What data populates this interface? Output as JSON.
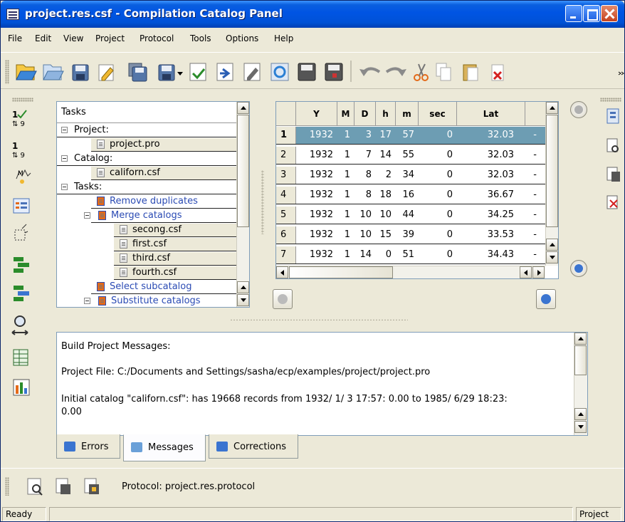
{
  "window": {
    "title": "project.res.csf - Compilation Catalog Panel"
  },
  "menu": [
    "File",
    "Edit",
    "View",
    "Project",
    "Protocol",
    "Tools",
    "Options",
    "Help"
  ],
  "toolbar_icons": [
    "open-folder-icon",
    "open-project-icon",
    "save-icon",
    "edit-icon",
    "save-all-icon",
    "save-as-icon",
    "dropdown-arrow-icon",
    "import-icon",
    "export-icon",
    "edit-catalog-icon",
    "refresh-icon",
    "save-catalog-icon",
    "save-catalog-alt-icon",
    "undo-icon",
    "redo-icon",
    "cut-icon",
    "copy-icon",
    "paste-icon",
    "delete-icon",
    "overflow-icon"
  ],
  "tasks": {
    "header": "Tasks",
    "items": [
      {
        "label": "Project:",
        "level": 0,
        "expander": true
      },
      {
        "label": "project.pro",
        "level": 1,
        "file": true
      },
      {
        "label": "Catalog:",
        "level": 0,
        "expander": true
      },
      {
        "label": "californ.csf",
        "level": 1,
        "file": true
      },
      {
        "label": "Tasks:",
        "level": 0,
        "expander": true
      },
      {
        "label": "Remove duplicates",
        "level": 1,
        "link": true
      },
      {
        "label": "Merge catalogs",
        "level": 1,
        "link": true,
        "expander": true
      },
      {
        "label": "secong.csf",
        "level": 2,
        "file": true
      },
      {
        "label": "first.csf",
        "level": 2,
        "file": true
      },
      {
        "label": "third.csf",
        "level": 2,
        "file": true
      },
      {
        "label": "fourth.csf",
        "level": 2,
        "file": true
      },
      {
        "label": "Select subcatalog",
        "level": 1,
        "link": true
      },
      {
        "label": "Substitute catalogs",
        "level": 1,
        "link": true,
        "expander": true
      }
    ]
  },
  "table": {
    "columns": [
      "Y",
      "M",
      "D",
      "h",
      "m",
      "sec",
      "Lat"
    ],
    "rows": [
      {
        "n": "1",
        "cells": [
          "1932",
          "1",
          "3",
          "17",
          "57",
          "0",
          "32.03"
        ],
        "selected": true
      },
      {
        "n": "2",
        "cells": [
          "1932",
          "1",
          "7",
          "14",
          "55",
          "0",
          "32.03"
        ]
      },
      {
        "n": "3",
        "cells": [
          "1932",
          "1",
          "8",
          "2",
          "34",
          "0",
          "32.03"
        ]
      },
      {
        "n": "4",
        "cells": [
          "1932",
          "1",
          "8",
          "18",
          "16",
          "0",
          "36.67"
        ]
      },
      {
        "n": "5",
        "cells": [
          "1932",
          "1",
          "10",
          "10",
          "44",
          "0",
          "34.25"
        ]
      },
      {
        "n": "6",
        "cells": [
          "1932",
          "1",
          "10",
          "15",
          "39",
          "0",
          "33.53"
        ]
      },
      {
        "n": "7",
        "cells": [
          "1932",
          "1",
          "14",
          "0",
          "51",
          "0",
          "34.43"
        ]
      }
    ],
    "overflow_mark": "-"
  },
  "messages": {
    "lines": [
      "Build Project Messages:",
      "Project File: C:/Documents and Settings/sasha/ecp/examples/project/project.pro",
      "Initial catalog \"californ.csf\":  has 19668 records from 1932/ 1/ 3 17:57: 0.00 to 1985/ 6/29 18:23:",
      "0.00"
    ]
  },
  "tabs": [
    {
      "label": "Errors",
      "active": false,
      "icon": "errors-icon"
    },
    {
      "label": "Messages",
      "active": true,
      "icon": "messages-icon"
    },
    {
      "label": "Corrections",
      "active": false,
      "icon": "corrections-icon"
    }
  ],
  "protocol": {
    "label": "Protocol: project.res.protocol"
  },
  "status": {
    "left": "Ready",
    "right": "Project"
  },
  "colors": {
    "title_blue": "#0054e3",
    "selected_row": "#6d9db3",
    "link": "#2b4bb4",
    "chrome": "#ece9d8"
  }
}
